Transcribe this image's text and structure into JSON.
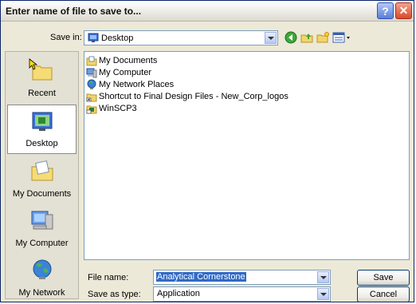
{
  "window": {
    "title": "Enter name of file to save to..."
  },
  "titlebar": {
    "help_glyph": "?",
    "close_glyph": "✕"
  },
  "save_in": {
    "label": "Save in:",
    "value": "Desktop"
  },
  "toolbar": {
    "icons": [
      "back-icon",
      "up-folder-icon",
      "new-folder-icon",
      "views-menu-icon"
    ]
  },
  "places": [
    {
      "label": "Recent",
      "icon": "recent-icon"
    },
    {
      "label": "Desktop",
      "icon": "desktop-icon",
      "selected": true
    },
    {
      "label": "My Documents",
      "icon": "my-documents-icon"
    },
    {
      "label": "My Computer",
      "icon": "my-computer-icon"
    },
    {
      "label": "My Network",
      "icon": "my-network-icon"
    }
  ],
  "files": [
    {
      "name": "My Documents",
      "icon": "documents-folder-icon"
    },
    {
      "name": "My Computer",
      "icon": "computer-icon"
    },
    {
      "name": "My Network Places",
      "icon": "network-places-icon"
    },
    {
      "name": "Shortcut to Final Design Files - New_Corp_logos",
      "icon": "folder-shortcut-icon"
    },
    {
      "name": "WinSCP3",
      "icon": "winscp-icon"
    }
  ],
  "file_name": {
    "label": "File name:",
    "value": "Analytical Cornerstone"
  },
  "save_as_type": {
    "label": "Save as type:",
    "value": "Application"
  },
  "buttons": {
    "save": "Save",
    "cancel": "Cancel"
  }
}
